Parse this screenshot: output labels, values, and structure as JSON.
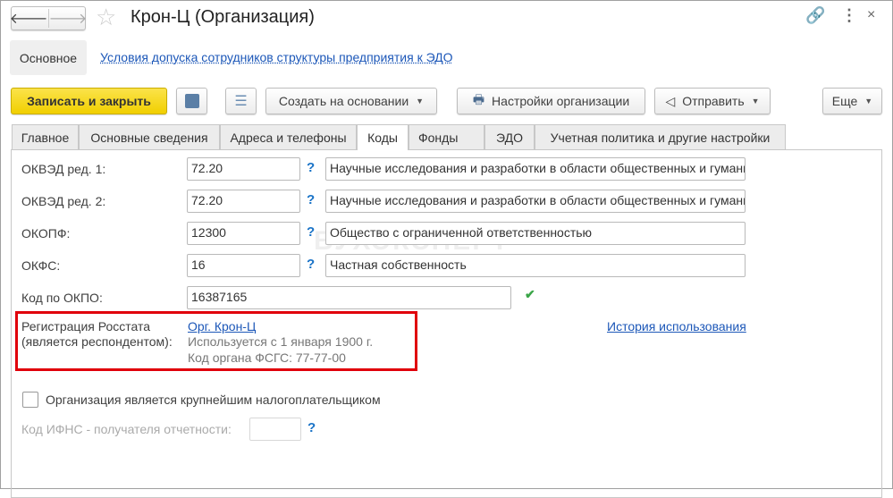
{
  "header": {
    "title": "Крон-Ц (Организация)"
  },
  "nav": {
    "main": "Основное",
    "link": "Условия допуска сотрудников структуры предприятия к ЭДО"
  },
  "toolbar": {
    "save_close": "Записать и закрыть",
    "create_based": "Создать на основании",
    "org_settings": "Настройки организации",
    "send": "Отправить",
    "more": "Еще"
  },
  "tabs": [
    "Главное",
    "Основные сведения",
    "Адреса и телефоны",
    "Коды",
    "Фонды",
    "ЭДО",
    "Учетная политика и другие настройки"
  ],
  "fields": {
    "okved1": {
      "label": "ОКВЭД ред. 1:",
      "value": "72.20",
      "desc": "Научные исследования и разработки в области общественных и гуманитарных наук"
    },
    "okved2": {
      "label": "ОКВЭД ред. 2:",
      "value": "72.20",
      "desc": "Научные исследования и разработки в области общественных и гуманитарных наук"
    },
    "okopf": {
      "label": "ОКОПФ:",
      "value": "12300",
      "desc": "Общество с ограниченной ответственностью"
    },
    "okfs": {
      "label": "ОКФС:",
      "value": "16",
      "desc": "Частная собственность"
    },
    "okpo": {
      "label": "Код по ОКПО:",
      "value": "16387165"
    },
    "help": "?"
  },
  "rosstat": {
    "label1": "Регистрация Росстата",
    "label2": "(является респондентом):",
    "link": "Орг. Крон-Ц",
    "used_since": "Используется с 1 января 1900 г.",
    "fsgs_code": "Код органа ФСГС: 77-77-00",
    "history": "История использования"
  },
  "largest_taxpayer": {
    "label": "Организация является крупнейшим налогоплательщиком",
    "checked": false
  },
  "ifns": {
    "label": "Код ИФНС - получателя отчетности:",
    "value": ""
  },
  "watermark": "БУХЭКСПЕРТ",
  "colors": {
    "primary_button": "#f5d213",
    "link": "#1c57b8",
    "highlight": "#e0000b"
  }
}
